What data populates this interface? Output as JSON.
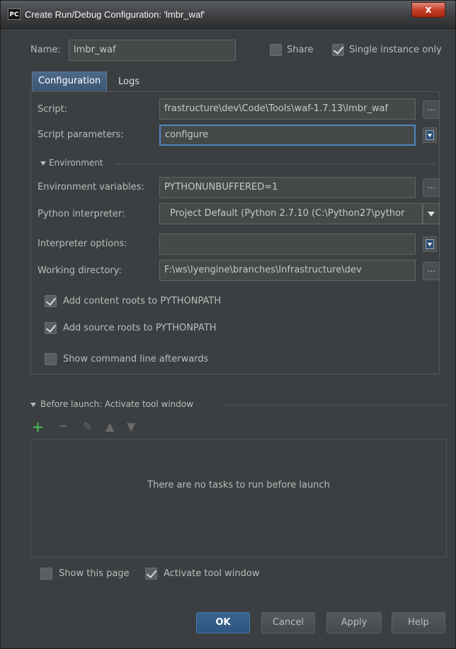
{
  "window": {
    "app_icon": "PC",
    "title": "Create Run/Debug Configuration: 'lmbr_waf'",
    "close_label": "x"
  },
  "name_row": {
    "label": "Name:",
    "value": "lmbr_waf",
    "share_label": "Share",
    "share_checked": false,
    "single_instance_label": "Single instance only",
    "single_instance_checked": true
  },
  "tabs": [
    {
      "label": "Configuration",
      "active": true
    },
    {
      "label": "Logs",
      "active": false
    }
  ],
  "config": {
    "script_label": "Script:",
    "script_value": "frastructure\\dev\\Code\\Tools\\waf-1.7.13\\lmbr_waf",
    "script_params_label": "Script parameters:",
    "script_params_value": "configure",
    "environment_section": "Environment",
    "env_vars_label": "Environment variables:",
    "env_vars_value": "PYTHONUNBUFFERED=1",
    "interpreter_label": "Python interpreter:",
    "interpreter_value": "Project Default (Python 2.7.10 (C:\\Python27\\pythor",
    "interp_options_label": "Interpreter options:",
    "interp_options_value": "",
    "workdir_label": "Working directory:",
    "workdir_value": "F:\\ws\\lyengine\\branches\\Infrastructure\\dev",
    "ellipsis": "...",
    "add_content_roots_label": "Add content roots to PYTHONPATH",
    "add_content_roots_checked": true,
    "add_source_roots_label": "Add source roots to PYTHONPATH",
    "add_source_roots_checked": true,
    "show_cmdline_label": "Show command line afterwards",
    "show_cmdline_checked": false
  },
  "before_launch": {
    "title": "Before launch: Activate tool window",
    "empty_text": "There are no tasks to run before launch",
    "toolbar": [
      "add-icon",
      "remove-icon",
      "edit-icon",
      "move-up-icon",
      "move-down-icon"
    ]
  },
  "footer": {
    "show_page_label": "Show this page",
    "show_page_checked": false,
    "activate_tool_label": "Activate tool window",
    "activate_tool_checked": true
  },
  "buttons": {
    "ok": "OK",
    "cancel": "Cancel",
    "apply": "Apply",
    "help": "Help"
  },
  "colors": {
    "background": "#3c3f41",
    "accent": "#4f86c2",
    "add_green": "#4caf50"
  }
}
